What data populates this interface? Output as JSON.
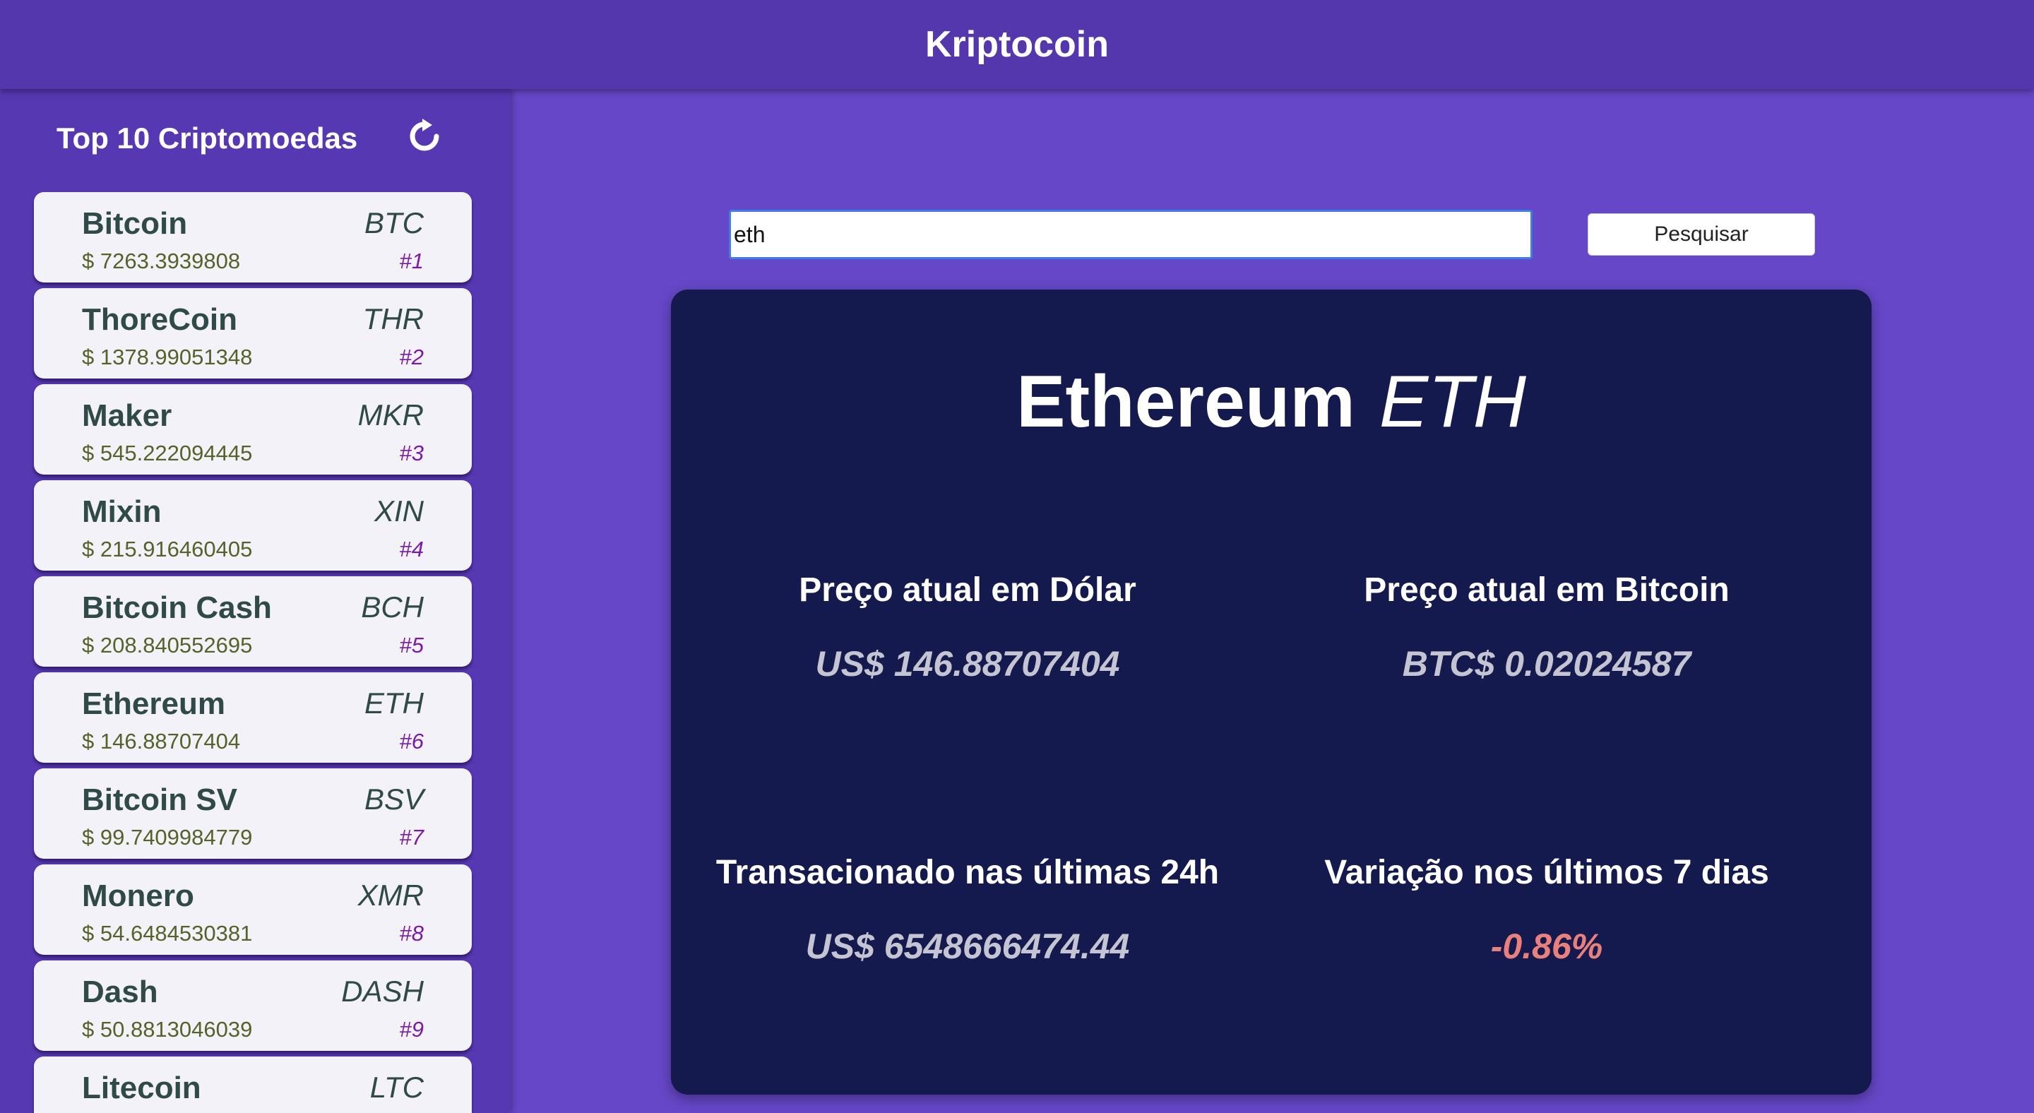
{
  "app": {
    "title": "Kriptocoin"
  },
  "sidebar": {
    "title": "Top 10 Criptomoedas",
    "refresh_icon": "refresh-icon",
    "coins": [
      {
        "name": "Bitcoin",
        "symbol": "BTC",
        "price": "$ 7263.3939808",
        "rank": "#1"
      },
      {
        "name": "ThoreCoin",
        "symbol": "THR",
        "price": "$ 1378.99051348",
        "rank": "#2"
      },
      {
        "name": "Maker",
        "symbol": "MKR",
        "price": "$ 545.222094445",
        "rank": "#3"
      },
      {
        "name": "Mixin",
        "symbol": "XIN",
        "price": "$ 215.916460405",
        "rank": "#4"
      },
      {
        "name": "Bitcoin Cash",
        "symbol": "BCH",
        "price": "$ 208.840552695",
        "rank": "#5"
      },
      {
        "name": "Ethereum",
        "symbol": "ETH",
        "price": "$ 146.88707404",
        "rank": "#6"
      },
      {
        "name": "Bitcoin SV",
        "symbol": "BSV",
        "price": "$ 99.7409984779",
        "rank": "#7"
      },
      {
        "name": "Monero",
        "symbol": "XMR",
        "price": "$ 54.6484530381",
        "rank": "#8"
      },
      {
        "name": "Dash",
        "symbol": "DASH",
        "price": "$ 50.8813046039",
        "rank": "#9"
      },
      {
        "name": "Litecoin",
        "symbol": "LTC",
        "price": "",
        "rank": ""
      }
    ]
  },
  "search": {
    "value": "eth",
    "button_label": "Pesquisar"
  },
  "detail": {
    "name": "Ethereum",
    "symbol": "ETH",
    "price_usd_label": "Preço atual em Dólar",
    "price_usd_value": "US$ 146.88707404",
    "price_btc_label": "Preço atual em Bitcoin",
    "price_btc_value": "BTC$ 0.02024587",
    "volume_label": "Transacionado nas últimas 24h",
    "volume_value": "US$ 6548666474.44",
    "change_label": "Variação nos últimos 7 dias",
    "change_value": "-0.86%"
  },
  "colors": {
    "background": "#6647c8",
    "topbar": "#5436ad",
    "sidebar": "#5638b2",
    "card": "#151a4e",
    "negative": "#e9807c",
    "rank": "#7b1aa6"
  }
}
